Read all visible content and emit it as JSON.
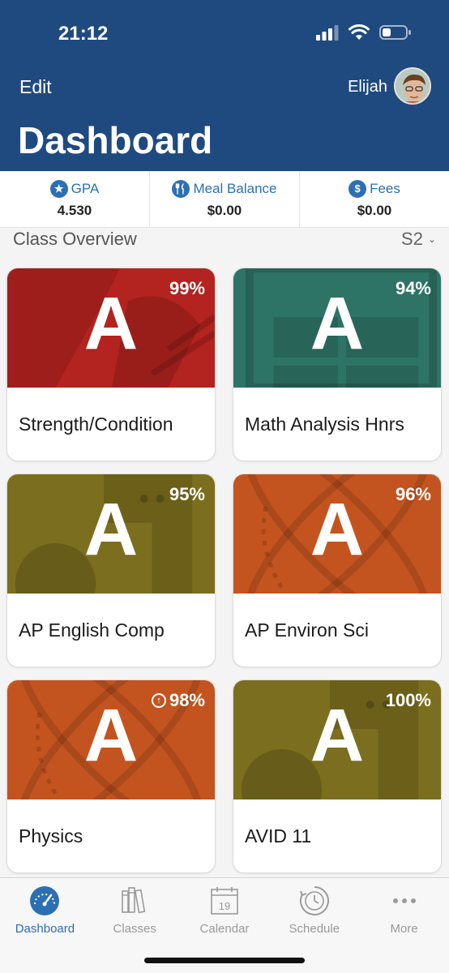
{
  "status_bar": {
    "time": "21:12"
  },
  "header": {
    "edit_label": "Edit",
    "user_name": "Elijah",
    "title": "Dashboard"
  },
  "stats": [
    {
      "label": "GPA",
      "value": "4.530",
      "icon": "star-icon"
    },
    {
      "label": "Meal Balance",
      "value": "$0.00",
      "icon": "utensils-icon"
    },
    {
      "label": "Fees",
      "value": "$0.00",
      "icon": "dollar-icon"
    }
  ],
  "overview": {
    "title": "Class Overview",
    "semester": "S2"
  },
  "classes": [
    {
      "name": "Strength/Condition",
      "grade": "A",
      "percent": "99%",
      "color": "#b3231f",
      "pattern": "whistle"
    },
    {
      "name": "Math Analysis Hnrs",
      "grade": "A",
      "percent": "94%",
      "color": "#2e7466",
      "pattern": "calculator"
    },
    {
      "name": "AP English Comp",
      "grade": "A",
      "percent": "95%",
      "color": "#7b6e1e",
      "pattern": "apple"
    },
    {
      "name": "AP Environ Sci",
      "grade": "A",
      "percent": "96%",
      "color": "#c4541f",
      "pattern": "atom"
    },
    {
      "name": "Physics",
      "grade": "A",
      "percent": "98%",
      "color": "#c4541f",
      "pattern": "atom",
      "trend": "up"
    },
    {
      "name": "AVID 11",
      "grade": "A",
      "percent": "100%",
      "color": "#7b6e1e",
      "pattern": "apple"
    }
  ],
  "tabbar": {
    "items": [
      {
        "label": "Dashboard",
        "icon": "gauge-icon",
        "active": true
      },
      {
        "label": "Classes",
        "icon": "books-icon",
        "active": false
      },
      {
        "label": "Calendar",
        "icon": "calendar-icon",
        "active": false,
        "day": "19"
      },
      {
        "label": "Schedule",
        "icon": "clock-icon",
        "active": false
      },
      {
        "label": "More",
        "icon": "more-icon",
        "active": false
      }
    ]
  }
}
